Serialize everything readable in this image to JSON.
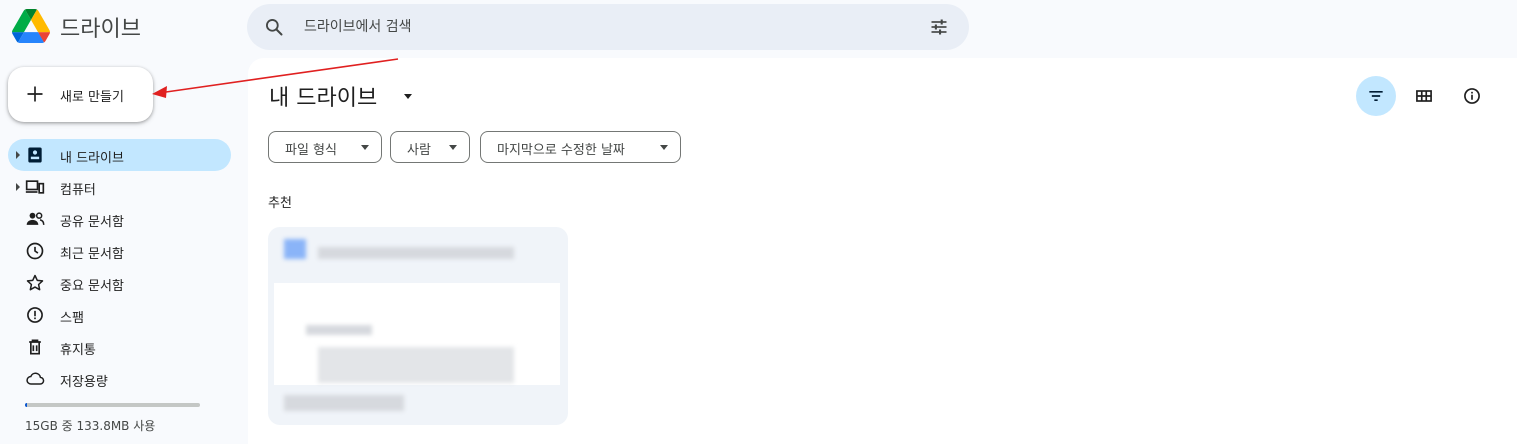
{
  "app": {
    "title": "드라이브"
  },
  "search": {
    "placeholder": "드라이브에서 검색"
  },
  "new_button": {
    "label": "새로 만들기"
  },
  "sidebar": {
    "items": [
      {
        "label": "내 드라이브",
        "icon": "my-drive-icon",
        "active": true
      },
      {
        "label": "컴퓨터",
        "icon": "computer-icon"
      },
      {
        "label": "공유 문서함",
        "icon": "shared-icon"
      },
      {
        "label": "최근 문서함",
        "icon": "recent-clock-icon"
      },
      {
        "label": "중요 문서함",
        "icon": "star-icon"
      },
      {
        "label": "스팸",
        "icon": "spam-icon"
      },
      {
        "label": "휴지통",
        "icon": "trash-icon"
      },
      {
        "label": "저장용량",
        "icon": "cloud-icon"
      }
    ],
    "storage": {
      "text": "15GB 중 133.8MB 사용",
      "used_fraction": 0.009
    }
  },
  "main": {
    "title": "내 드라이브",
    "filters": [
      "파일 형식",
      "사람",
      "마지막으로 수정한 날짜"
    ],
    "section": "추천"
  },
  "colors": {
    "accent": "#c2e7ff",
    "brand_blue": "#0b57d0",
    "annotation": "#e02020"
  }
}
